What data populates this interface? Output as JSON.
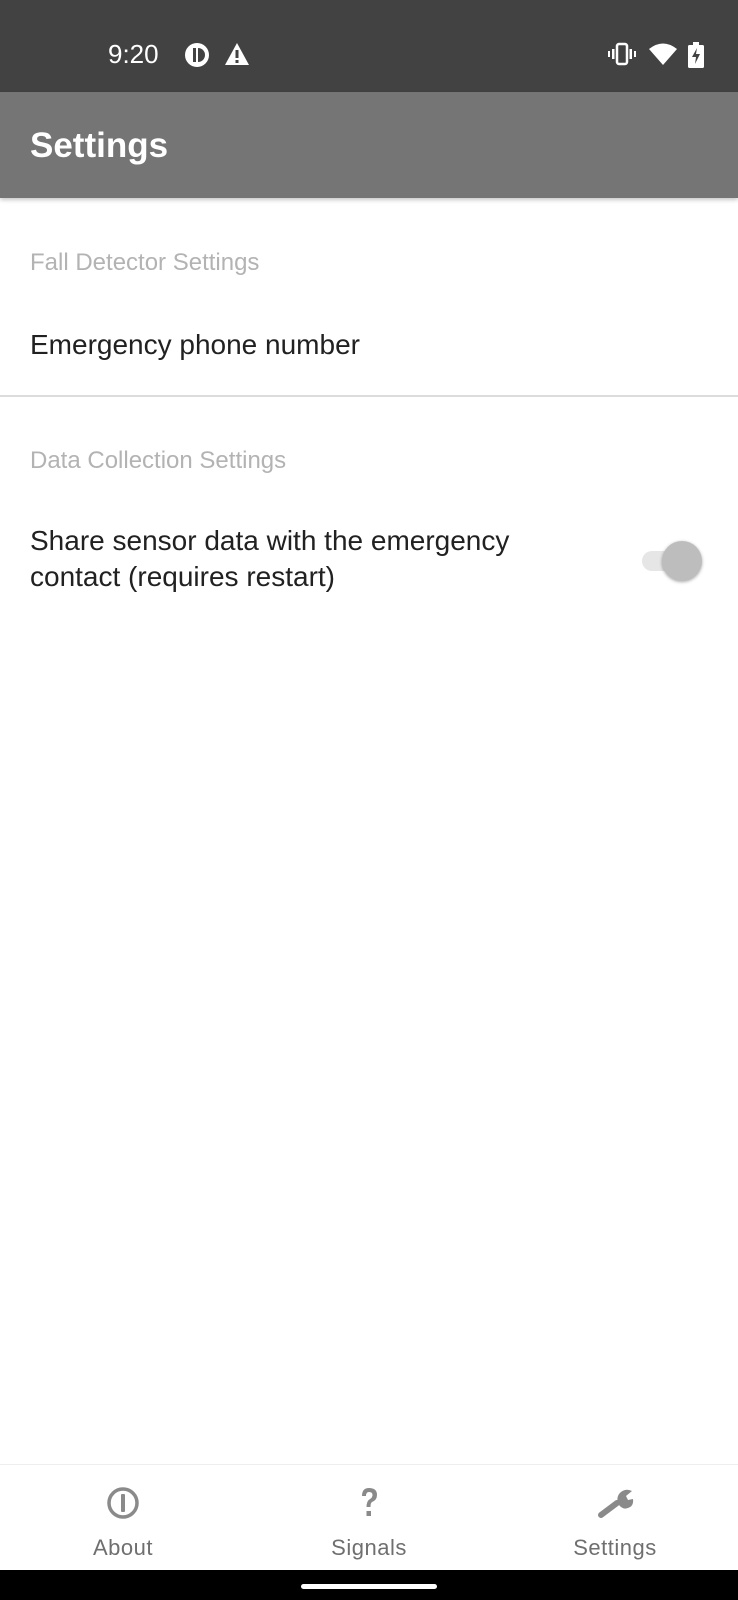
{
  "status_bar": {
    "time": "9:20",
    "icons": [
      "data-saver-icon",
      "alert-icon",
      "vibrate-icon",
      "wifi-icon",
      "battery-charging-icon"
    ]
  },
  "app_bar": {
    "title": "Settings"
  },
  "preferences": {
    "fall_detector_category": "Fall Detector Settings",
    "emergency_phone_title": "Emergency phone number",
    "data_collection_category": "Data Collection Settings",
    "share_data_title_line1": "Share sensor data with the emergency",
    "share_data_title_line2": "contact (requires restart)",
    "share_data_enabled": false
  },
  "bottom_nav": {
    "items": [
      {
        "label": "About",
        "icon": "info-circle-icon"
      },
      {
        "label": "Signals",
        "icon": "question-mark-icon"
      },
      {
        "label": "Settings",
        "icon": "wrench-icon"
      }
    ]
  },
  "colors": {
    "status_bar": "#424242",
    "app_bar": "#757575",
    "category_text": "#b3b3b3",
    "nav_icon": "#8a8a8a"
  }
}
